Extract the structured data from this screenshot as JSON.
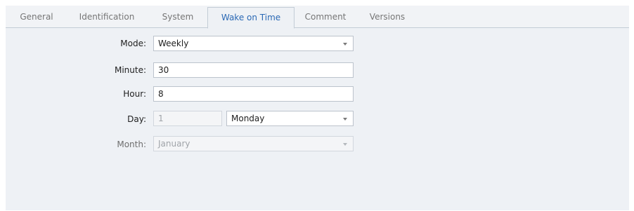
{
  "tabs": [
    {
      "label": "General",
      "active": false
    },
    {
      "label": "Identification",
      "active": false
    },
    {
      "label": "System",
      "active": false
    },
    {
      "label": "Wake on Time",
      "active": true
    },
    {
      "label": "Comment",
      "active": false
    },
    {
      "label": "Versions",
      "active": false
    }
  ],
  "form": {
    "mode": {
      "label": "Mode:",
      "value": "Weekly",
      "icon": "chevron-down-icon"
    },
    "minute": {
      "label": "Minute:",
      "value": "30"
    },
    "hour": {
      "label": "Hour:",
      "value": "8"
    },
    "day": {
      "label": "Day:",
      "number_value": "1",
      "weekday_value": "Monday",
      "number_enabled": false,
      "icon": "chevron-down-icon"
    },
    "month": {
      "label": "Month:",
      "value": "January",
      "enabled": false,
      "icon": "chevron-down-icon"
    }
  },
  "colors": {
    "active_tab_text": "#2b69b5",
    "inactive_tab_text": "#767676",
    "panel_background": "#eef1f5",
    "field_border": "#bcc3cc",
    "disabled_text": "#a0a4a9"
  }
}
